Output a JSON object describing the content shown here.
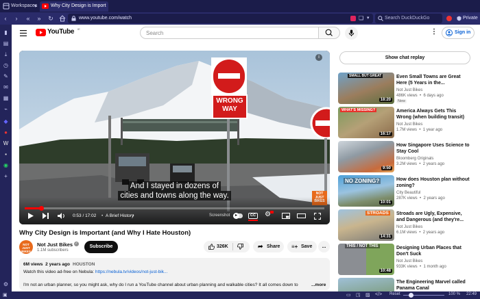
{
  "browser": {
    "workspaces_label": "Workspaces",
    "tab_title": "Why City Design is Import",
    "url": "www.youtube.com/watch",
    "search_placeholder": "Search DuckDuckGo",
    "private_label": "Private",
    "zoom": "100 %",
    "reset_label": "Reset",
    "clock": "22:49",
    "accent": "#2a2b6a"
  },
  "youtube": {
    "logo_text": "YouTube",
    "logo_sup": "IE",
    "search_placeholder": "Search",
    "sign_in": "Sign in"
  },
  "player": {
    "subtitle_line1": "And I stayed in dozens of",
    "subtitle_line2": "cities and towns along the way.",
    "sign_wrong": "WRONG",
    "sign_way": "WAY",
    "time": "0:53 / 17:02",
    "chapter": "A Brief History",
    "chapter_arrow": "›",
    "screenshot_label": "Screenshot",
    "cc_label": "CC",
    "watermark": "NOT JUST BIKES",
    "info_glyph": "i",
    "progress": 0.052
  },
  "video": {
    "title": "Why City Design is Important (and Why I Hate Houston)",
    "channel": "Not Just Bikes",
    "subscribers": "1.1M subscribers",
    "subscribe": "Subscribe",
    "likes": "326K",
    "share": "Share",
    "save": "Save",
    "more": "...",
    "views_date": "6M views  2 years ago",
    "tag": "HOUSTON",
    "desc_line1_prefix": "Watch this video ad-free on Nebula: ",
    "desc_link": "https://nebula.tv/videos/not-just-bik...",
    "desc_line2": "I'm not an urban planner, so you might ask, why do I run a YouTube channel about urban planning and walkable cities? It all comes down to ",
    "desc_more": "...more"
  },
  "chat_replay": "Show chat replay",
  "recommendations": [
    {
      "title": "Even Small Towns are Great Here (5 Years in the...",
      "channel": "Not Just Bikes",
      "meta": "486K views  •  6 days ago",
      "badge": "New",
      "duration": "18:20",
      "thumb_text": "SMALL BUT GREAT"
    },
    {
      "title": "America Always Gets This Wrong (when building transit)",
      "channel": "Not Just Bikes",
      "meta": "1.7M views  •  1 year ago",
      "badge": "",
      "duration": "16:17",
      "thumb_text": "WHAT'S MISSING?"
    },
    {
      "title": "How Singapore Uses Science to Stay Cool",
      "channel": "Bloomberg Originals",
      "meta": "3.2M views  •  2 years ago",
      "badge": "",
      "duration": "9:50",
      "thumb_text": ""
    },
    {
      "title": "How does Houston plan without zoning?",
      "channel": "City Beautiful",
      "meta": "287K views  •  2 years ago",
      "badge": "",
      "duration": "10:01",
      "thumb_text": "NO ZONING?"
    },
    {
      "title": "Stroads are Ugly, Expensive, and Dangerous (and they're...",
      "channel": "Not Just Bikes",
      "meta": "6.1M views  •  2 years ago",
      "badge": "",
      "duration": "14:31",
      "thumb_text": "STROADS"
    },
    {
      "title": "Designing Urban Places that Don't Suck",
      "channel": "Not Just Bikes",
      "meta": "933K views  •  1 month ago",
      "badge": "",
      "duration": "10:48",
      "thumb_text": "THIS / NOT THIS"
    },
    {
      "title": "The Engineering Marvel called Panama Canal",
      "channel": "",
      "meta": "",
      "badge": "",
      "duration": "",
      "thumb_text": ""
    }
  ]
}
